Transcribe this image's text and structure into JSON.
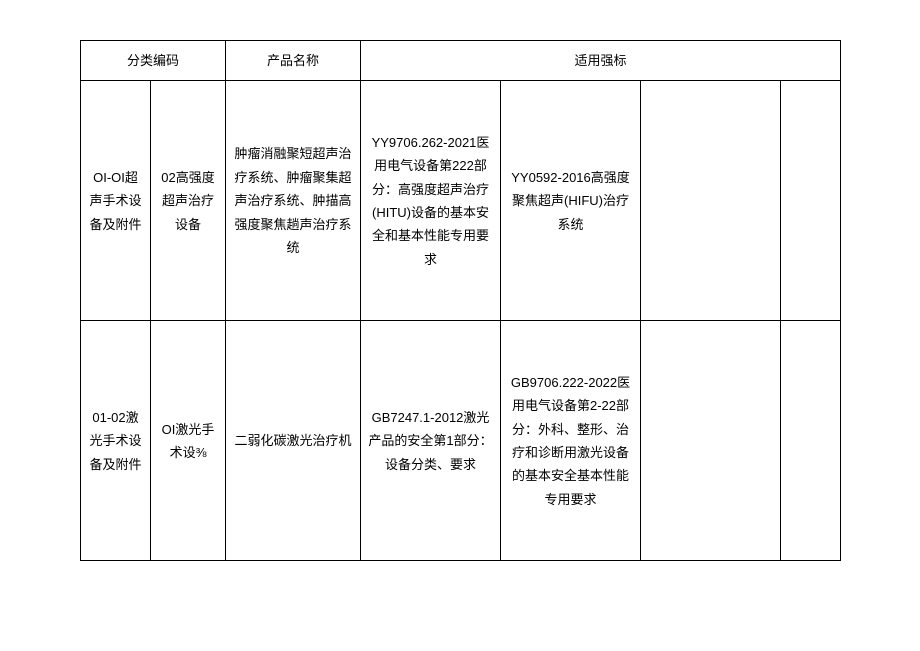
{
  "headers": {
    "code": "分类编码",
    "name": "产品名称",
    "standard": "适用强标"
  },
  "rows": [
    {
      "codeA": "OI-OI超声手术设备及附件",
      "codeB": "02高强度超声治疗设备",
      "name": "肿瘤消融聚短超声治疗系统、肿瘤聚集超声治疗系统、肿描高强度聚焦趟声治疗系统",
      "stdA": "YY9706.262-2021医用电气设备第222部分：高强度超声治疗(HITU)设备的基本安全和基本性能专用要求",
      "stdB": "YY0592-2016高强度聚焦超声(HIFU)治疗系统",
      "stdC": "",
      "stdD": ""
    },
    {
      "codeA": "01-02激光手术设备及附件",
      "codeB": "OI激光手术设⅜",
      "name": "二弱化碳激光治疗机",
      "stdA": "GB7247.1-2012激光产品的安全第1部分：设备分类、要求",
      "stdB": "GB9706.222-2022医用电气设备第2-22部分：外科、整形、治疗和诊断用激光设备的基本安全基本性能专用要求",
      "stdC": "",
      "stdD": ""
    }
  ]
}
